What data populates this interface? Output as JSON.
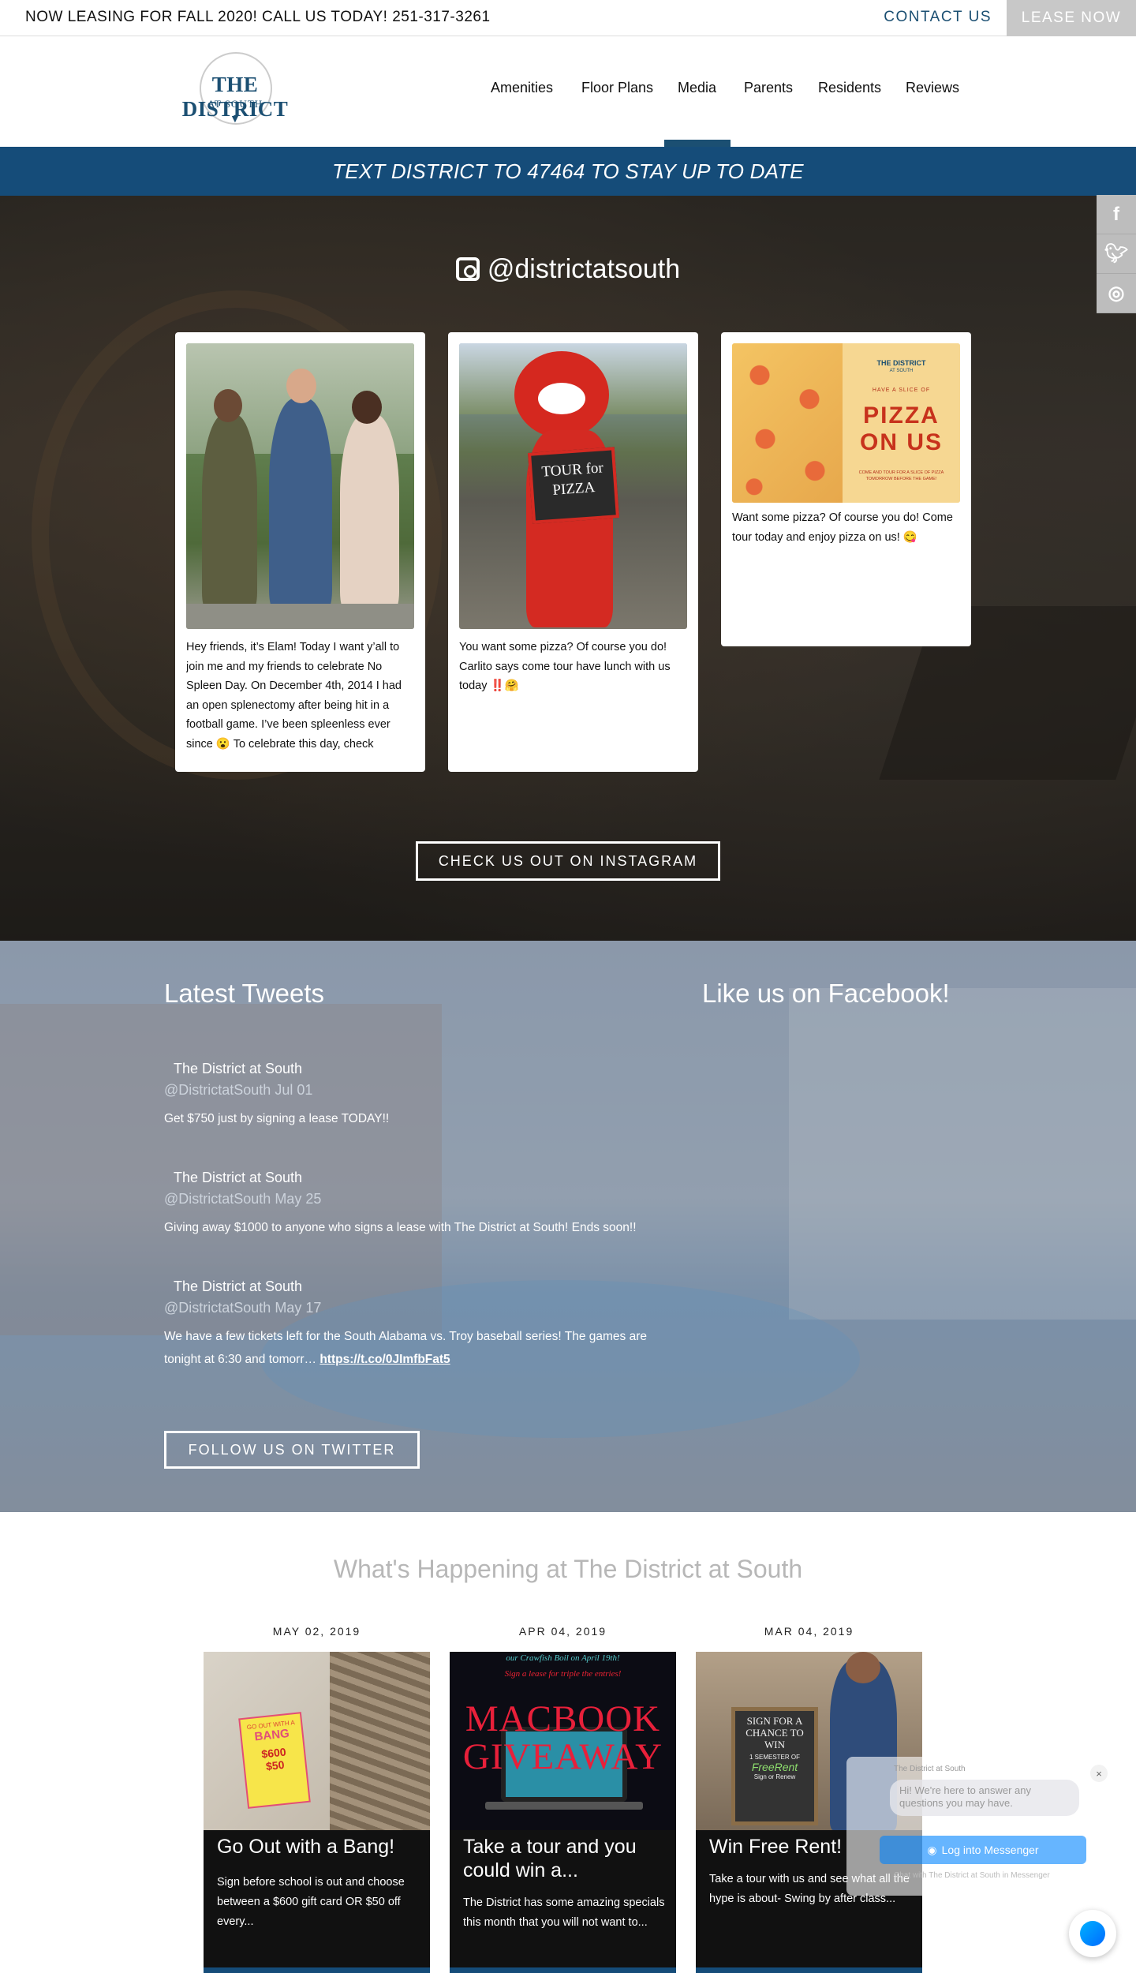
{
  "topbar": {
    "announcement": "NOW LEASING FOR FALL 2020! CALL US TODAY! 251-317-3261",
    "contact_label": "CONTACT US",
    "lease_label": "LEASE NOW"
  },
  "logo": {
    "line1": "THE DISTRICT",
    "line2": "AT SOUTH"
  },
  "nav": {
    "items": [
      "Amenities",
      "Floor Plans",
      "Media",
      "Parents",
      "Residents",
      "Reviews"
    ],
    "active": "Media"
  },
  "banner": {
    "text": "TEXT DISTRICT TO 47464 TO STAY UP TO DATE"
  },
  "instagram": {
    "handle": "@districtatsouth",
    "posts": [
      {
        "caption": "Hey friends, it’s Elam! Today I want y’all to join me and my friends to celebrate No Spleen Day. On December 4th, 2014 I had an open splenectomy after being hit in a football game. I’ve been spleenless ever since 😮 To celebrate this day, check"
      },
      {
        "caption": "You want some pizza? Of course you do! Carlito says come tour have lunch with us today ‼️🤗",
        "sign_text": "TOUR for PIZZA"
      },
      {
        "caption": "Want some pizza? Of course you do! Come tour today and enjoy pizza on us! 😋",
        "flyer_brand": "THE DISTRICT",
        "flyer_sub": "AT SOUTH",
        "flyer_small": "HAVE A SLICE OF",
        "flyer_title": "PIZZA ON US",
        "flyer_note": "COME AND TOUR FOR A SLICE OF PIZZA TOMORROW BEFORE THE GAME!"
      }
    ],
    "button_label": "CHECK US OUT ON INSTAGRAM"
  },
  "social_tabs": [
    "facebook-icon",
    "twitter-icon",
    "instagram-icon"
  ],
  "tweets": {
    "title": "Latest Tweets",
    "items": [
      {
        "name": "The District at South",
        "handle_date": "@DistrictatSouth Jul 01",
        "text": "Get $750 just by signing a lease TODAY!!",
        "link": ""
      },
      {
        "name": "The District at South",
        "handle_date": "@DistrictatSouth May 25",
        "text": "Giving away $1000 to anyone who signs a lease with The District at South! Ends soon!!",
        "link": ""
      },
      {
        "name": "The District at South",
        "handle_date": "@DistrictatSouth May 17",
        "text": "We have a few tickets left for the South Alabama vs. Troy baseball series! The games are tonight at 6:30 and tomorr… ",
        "link": "https://t.co/0JImfbFat5"
      }
    ],
    "button_label": "FOLLOW US ON TWITTER"
  },
  "facebook": {
    "title": "Like us on Facebook!"
  },
  "happenings": {
    "title": "What's Happening at The District at South",
    "posts": [
      {
        "date": "MAY 02, 2019",
        "title": "Go Out with a Bang!",
        "desc": "Sign before school is out and choose between a $600 gift card OR $50 off every...",
        "img_text_a": "GO OUT WITH A",
        "img_text_b": "BANG",
        "img_text_c": "$600",
        "img_text_d": "$50"
      },
      {
        "date": "APR 04, 2019",
        "title": "Take a tour and you could win a...",
        "desc": "The District has some amazing specials this month that you will not want to...",
        "img_text_a": "MACBOOK",
        "img_text_b": "GIVEAWAY",
        "img_text_c": "our Crawfish Boil on April 19th!",
        "img_text_d": "Sign a lease for triple the entries!"
      },
      {
        "date": "MAR 04, 2019",
        "title": "Win Free Rent!",
        "desc": "Take a tour with us and see what all the hype is about- Swing by after class...",
        "img_text_a": "SIGN FOR A CHANCE TO WIN",
        "img_text_b": "1 SEMESTER OF",
        "img_text_c": "FreeRent",
        "img_text_d": "Sign or Renew"
      }
    ]
  },
  "messenger": {
    "from": "The District at South",
    "greeting": "Hi! We're here to answer any questions you may have.",
    "close": "×",
    "login_label": "Log into Messenger",
    "chat_with": "Chat with The District at South in Messenger"
  }
}
